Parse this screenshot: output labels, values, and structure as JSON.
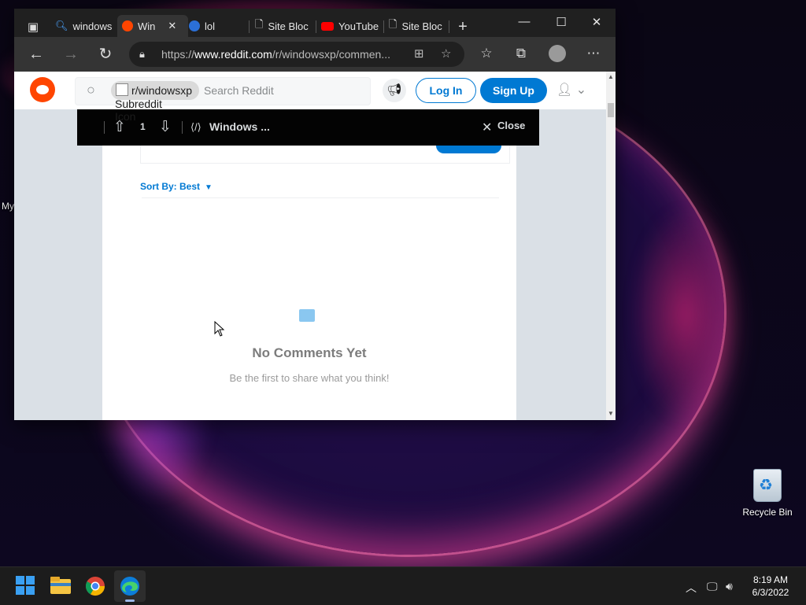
{
  "desktop": {
    "partial_label": "My",
    "recycle_bin_label": "Recycle Bin"
  },
  "browser": {
    "tabs": [
      {
        "label": "windows",
        "favicon": "search-icon",
        "color": "#4aa3ff"
      },
      {
        "label": "Win",
        "favicon": "reddit-icon",
        "color": "#ff4500",
        "active": true
      },
      {
        "label": "lol",
        "favicon": "edge-icon",
        "color": "#4aa3ff"
      },
      {
        "label": "Site Bloc",
        "favicon": "page-icon",
        "color": "#dddddd"
      },
      {
        "label": "YouTube",
        "favicon": "youtube-icon",
        "color": "#ff0000"
      },
      {
        "label": "Site Bloc",
        "favicon": "page-icon",
        "color": "#dddddd"
      }
    ],
    "url_host_prefix": "https://",
    "url_host": "www.reddit.com",
    "url_path": "/r/windowsxp/commen..."
  },
  "reddit": {
    "subreddit_chip": "r/windowsxp",
    "subreddit_icon_alt": "Subreddit Icon",
    "search_placeholder": "Search Reddit",
    "login_label": "Log In",
    "signup_label": "Sign Up",
    "overlay": {
      "vote_count": "1",
      "post_title": "Windows ...",
      "close_label": "Close"
    },
    "sort_by_label": "Sort By: Best",
    "no_comments_title": "No Comments Yet",
    "no_comments_sub": "Be the first to share what you think!"
  },
  "taskbar": {
    "time": "8:19 AM",
    "date": "6/3/2022"
  },
  "colors": {
    "reddit_blue": "#0079d3",
    "reddit_orange": "#ff4500"
  }
}
